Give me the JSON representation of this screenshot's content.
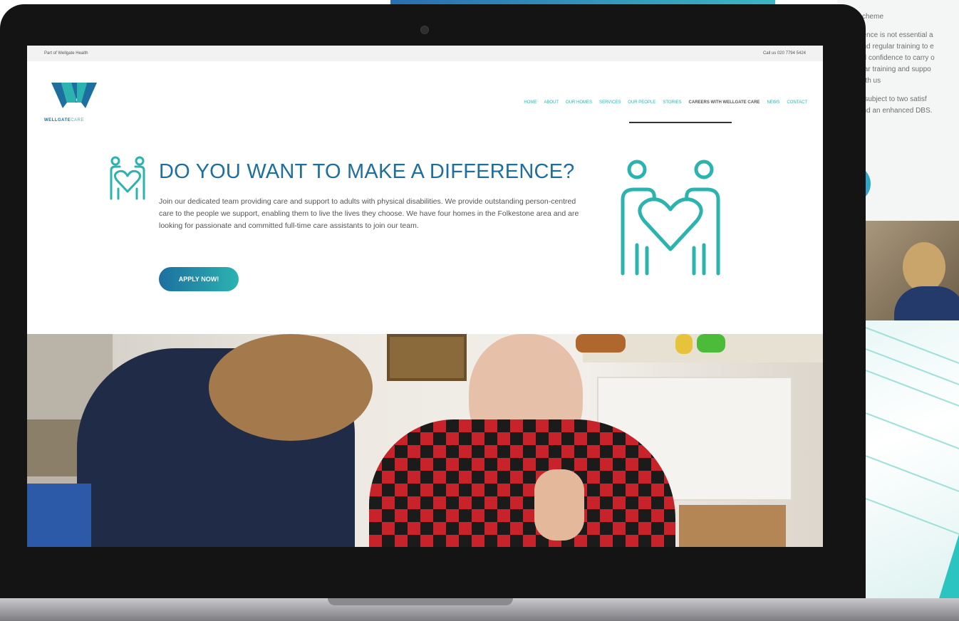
{
  "background": {
    "side_page_lines": [
      "scheme",
      "rience is not essential a",
      "and regular training to e",
      "nd confidence to carry o",
      "ular training and suppo",
      "with us",
      "",
      "e subject to two satisf",
      "and an enhanced DBS."
    ]
  },
  "site": {
    "topbar": {
      "left_text": "Part of Wellgate Health",
      "right_text": "Call us 020 7794 5424"
    },
    "logo": {
      "name_bold": "WELLGATE",
      "name_light": "CARE",
      "icon": "wellgate-w-logo"
    },
    "nav": [
      {
        "label": "HOME",
        "active": false
      },
      {
        "label": "ABOUT",
        "active": false
      },
      {
        "label": "OUR HOMES",
        "active": false
      },
      {
        "label": "SERVICES",
        "active": false
      },
      {
        "label": "OUR PEOPLE",
        "active": false
      },
      {
        "label": "STORIES",
        "active": false
      },
      {
        "label": "CAREERS WITH WELLGATE CARE",
        "active": true
      },
      {
        "label": "NEWS",
        "active": false
      },
      {
        "label": "CONTACT",
        "active": false
      }
    ],
    "hero": {
      "title": "DO YOU WANT TO MAKE A DIFFERENCE?",
      "body": "Join our dedicated team providing care and support to adults with physical disabilities. We provide outstanding person-centred care to the people we support, enabling them to live the lives they choose. We have four homes in the Folkestone area and are looking for passionate and committed full-time care assistants to join our team.",
      "cta_label": "APPLY NOW!",
      "icon": "two-people-heart-icon"
    }
  },
  "colors": {
    "brand_blue": "#1d6fa0",
    "brand_teal": "#2bb3b0",
    "text_grey": "#555555"
  }
}
